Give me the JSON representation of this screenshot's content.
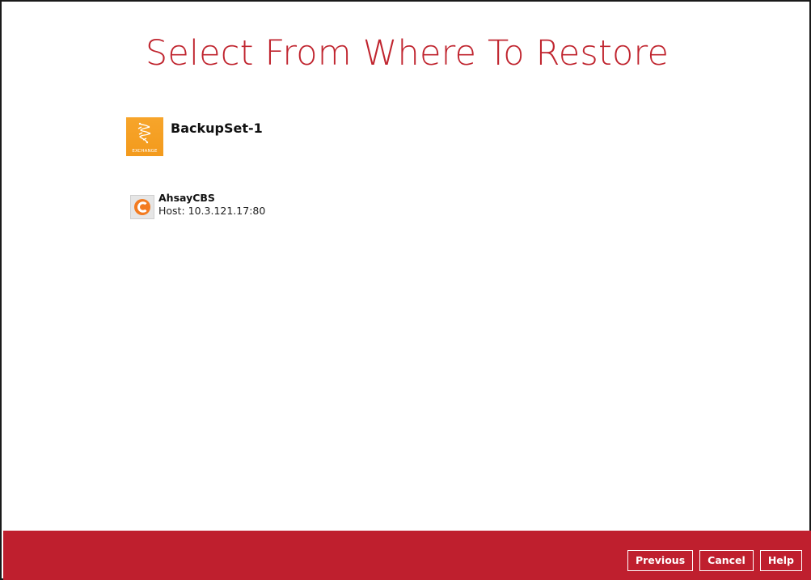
{
  "page": {
    "title": "Select From Where To Restore"
  },
  "backup_set": {
    "name": "BackupSet-1",
    "icon": "exchange-icon",
    "icon_label": "EXCHANGE",
    "icon_color": "#f5a623"
  },
  "destinations": [
    {
      "name": "AhsayCBS",
      "host": "Host: 10.3.121.17:80",
      "icon": "ahsay-cbs-icon",
      "icon_color": "#f37b20"
    }
  ],
  "footer": {
    "background": "#bf1f2e",
    "previous_label": "Previous",
    "cancel_label": "Cancel",
    "help_label": "Help"
  },
  "colors": {
    "accent": "#c0252f"
  }
}
